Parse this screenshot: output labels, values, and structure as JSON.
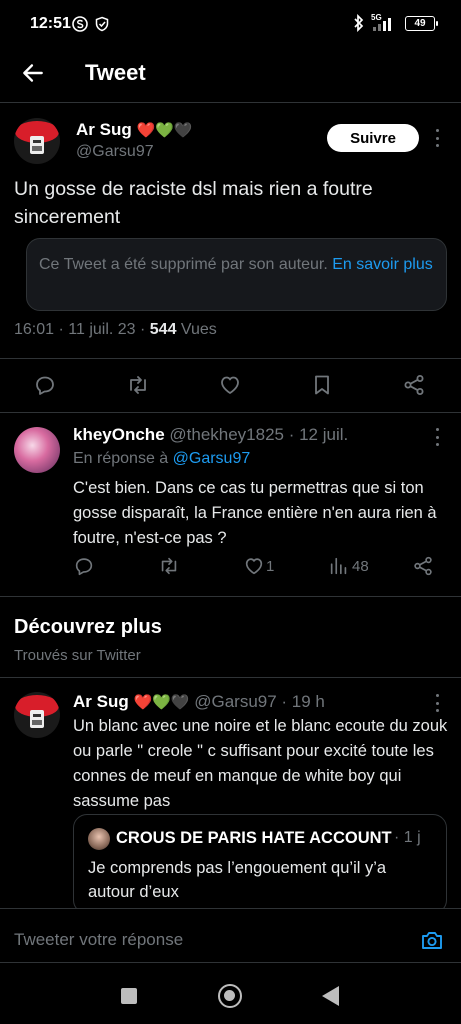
{
  "status": {
    "time": "12:51",
    "network": "5G",
    "battery": "49"
  },
  "header": {
    "title": "Tweet"
  },
  "tweet": {
    "name": "Ar Sug",
    "hearts": "❤️💚🖤",
    "handle": "@Garsu97",
    "follow_label": "Suivre",
    "text": "Un gosse de raciste dsl mais rien a foutre sincerement",
    "deleted_notice": "Ce Tweet a été supprimé par son auteur.",
    "deleted_link": "En savoir plus",
    "time": "16:01 · 11 juil. 23 · ",
    "views_count": "544",
    "views_label": " Vues"
  },
  "reply": {
    "name": "kheyOnche",
    "handle_date": " @thekhey1825 · 12 juil.",
    "in_reply_prefix": "En réponse à ",
    "in_reply_handle": "@Garsu97",
    "text": "C'est bien. Dans ce cas tu permettras que si ton gosse disparaît, la France entière n'en aura rien à foutre, n'est-ce pas ?",
    "likes": "1",
    "views": "48"
  },
  "discover": {
    "title": "Découvrez plus",
    "subtitle": "Trouvés sur Twitter",
    "name": "Ar Sug",
    "hearts": "❤️💚🖤",
    "handle_time": " @Garsu97 · 19 h",
    "text": "Un blanc avec une noire et le blanc ecoute du zouk ou parle \" creole \" c suffisant pour excité toute les connes de meuf en manque de white boy qui sassume pas",
    "quote": {
      "name": "CROUS DE PARIS HATE ACCOUNT",
      "time": "· 1 j",
      "text": "Je comprends pas l’engouement qu’il y’a autour d’eux"
    }
  },
  "composer": {
    "placeholder": "Tweeter votre réponse"
  },
  "colors": {
    "accent": "#1d9bf0",
    "background": "#000000",
    "muted": "#71767b"
  }
}
